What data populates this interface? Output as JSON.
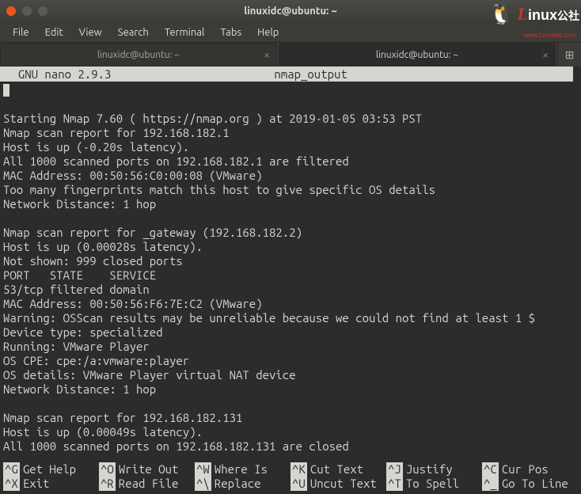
{
  "window": {
    "title": "linuxidc@ubuntu: ~"
  },
  "logo": {
    "penguin": "🐧",
    "text_l": "L",
    "text_rest": "inux",
    "suffix": "公社",
    "url": "www.Linuxidc.com"
  },
  "menubar": {
    "file": "File",
    "edit": "Edit",
    "view": "View",
    "search": "Search",
    "terminal": "Terminal",
    "tabs": "Tabs",
    "help": "Help"
  },
  "tabs": [
    {
      "label": "linuxidc@ubuntu: ~",
      "active": false
    },
    {
      "label": "linuxidc@ubuntu: ~",
      "active": true
    }
  ],
  "newtab_icon": "⊞",
  "nano_header": {
    "left": "  GNU nano 2.9.3",
    "filename": "nmap_output"
  },
  "content": [
    "",
    "Starting Nmap 7.60 ( https://nmap.org ) at 2019-01-05 03:53 PST",
    "Nmap scan report for 192.168.182.1",
    "Host is up (-0.20s latency).",
    "All 1000 scanned ports on 192.168.182.1 are filtered",
    "MAC Address: 00:50:56:C0:00:08 (VMware)",
    "Too many fingerprints match this host to give specific OS details",
    "Network Distance: 1 hop",
    "",
    "Nmap scan report for _gateway (192.168.182.2)",
    "Host is up (0.00028s latency).",
    "Not shown: 999 closed ports",
    "PORT   STATE    SERVICE",
    "53/tcp filtered domain",
    "MAC Address: 00:50:56:F6:7E:C2 (VMware)",
    "Warning: OSScan results may be unreliable because we could not find at least 1 $",
    "Device type: specialized",
    "Running: VMware Player",
    "OS CPE: cpe:/a:vmware:player",
    "OS details: VMware Player virtual NAT device",
    "Network Distance: 1 hop",
    "",
    "Nmap scan report for 192.168.182.131",
    "Host is up (0.00049s latency).",
    "All 1000 scanned ports on 192.168.182.131 are closed"
  ],
  "hotkeys": {
    "row1": [
      {
        "key": "^G",
        "label": "Get Help"
      },
      {
        "key": "^O",
        "label": "Write Out"
      },
      {
        "key": "^W",
        "label": "Where Is"
      },
      {
        "key": "^K",
        "label": "Cut Text"
      },
      {
        "key": "^J",
        "label": "Justify"
      },
      {
        "key": "^C",
        "label": "Cur Pos"
      }
    ],
    "row2": [
      {
        "key": "^X",
        "label": "Exit"
      },
      {
        "key": "^R",
        "label": "Read File"
      },
      {
        "key": "^\\",
        "label": "Replace"
      },
      {
        "key": "^U",
        "label": "Uncut Text"
      },
      {
        "key": "^T",
        "label": "To Spell"
      },
      {
        "key": "^_",
        "label": "Go To Line"
      }
    ]
  }
}
